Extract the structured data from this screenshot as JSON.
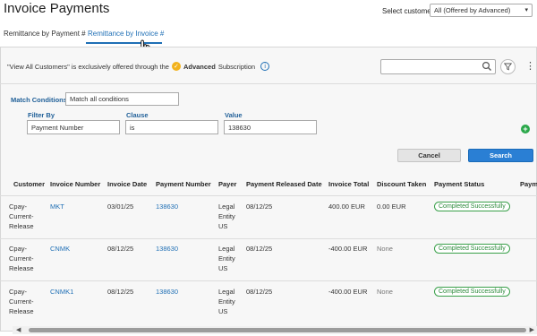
{
  "header": {
    "title": "Invoice Payments",
    "select_label": "Select customer",
    "select_value": "All (Offered by Advanced)"
  },
  "tabs": [
    {
      "label": "Remittance by Payment #",
      "active": false
    },
    {
      "label": "Remittance by Invoice #",
      "active": true
    }
  ],
  "promo": {
    "text_before": "\"View All Customers\" is exclusively offered through the",
    "tier": "Advanced",
    "text_after": "Subscription"
  },
  "search": {
    "value": ""
  },
  "match": {
    "label": "Match Conditions",
    "value": "Match all conditions"
  },
  "filters": {
    "filter_by_label": "Filter By",
    "filter_by_value": "Payment Number",
    "clause_label": "Clause",
    "clause_value": "is",
    "value_label": "Value",
    "value_value": "138630"
  },
  "buttons": {
    "cancel": "Cancel",
    "search": "Search"
  },
  "table": {
    "columns": [
      "Customer",
      "Invoice Number",
      "Invoice Date",
      "Payment Number",
      "Payer",
      "Payment Released Date",
      "Invoice Total",
      "Discount Taken",
      "Payment Status",
      "Paym"
    ],
    "rows": [
      {
        "customer": [
          "Cpay-",
          "Current-",
          "Release"
        ],
        "invoice_number": "MKT",
        "invoice_date": "03/01/25",
        "payment_number": "138630",
        "payer": [
          "Legal",
          "Entity",
          "US"
        ],
        "released_date": "08/12/25",
        "invoice_total": "400.00 EUR",
        "discount": "0.00 EUR",
        "status": "Completed Successfully"
      },
      {
        "customer": [
          "Cpay-",
          "Current-",
          "Release"
        ],
        "invoice_number": "CNMK",
        "invoice_date": "08/12/25",
        "payment_number": "138630",
        "payer": [
          "Legal",
          "Entity",
          "US"
        ],
        "released_date": "08/12/25",
        "invoice_total": "-400.00 EUR",
        "discount": "None",
        "status": "Completed Successfully"
      },
      {
        "customer": [
          "Cpay-",
          "Current-",
          "Release"
        ],
        "invoice_number": "CNMK1",
        "invoice_date": "08/12/25",
        "payment_number": "138630",
        "payer": [
          "Legal",
          "Entity",
          "US"
        ],
        "released_date": "08/12/25",
        "invoice_total": "-400.00 EUR",
        "discount": "None",
        "status": "Completed Successfully"
      }
    ]
  },
  "icons": {
    "select_chevron": "chevron-down-icon",
    "promo_badge": "check-badge-icon",
    "info": "info-icon",
    "search": "search-icon",
    "filter": "filter-icon",
    "more": "kebab-menu-icon",
    "add": "add-icon",
    "cursor": "hand-pointer-icon"
  },
  "colors": {
    "link": "#1f6fb5",
    "primary_button": "#2a7fd4",
    "status_green": "#2b8a3a",
    "add_green": "#2aa84a",
    "badge_gold": "#f2b21c"
  }
}
